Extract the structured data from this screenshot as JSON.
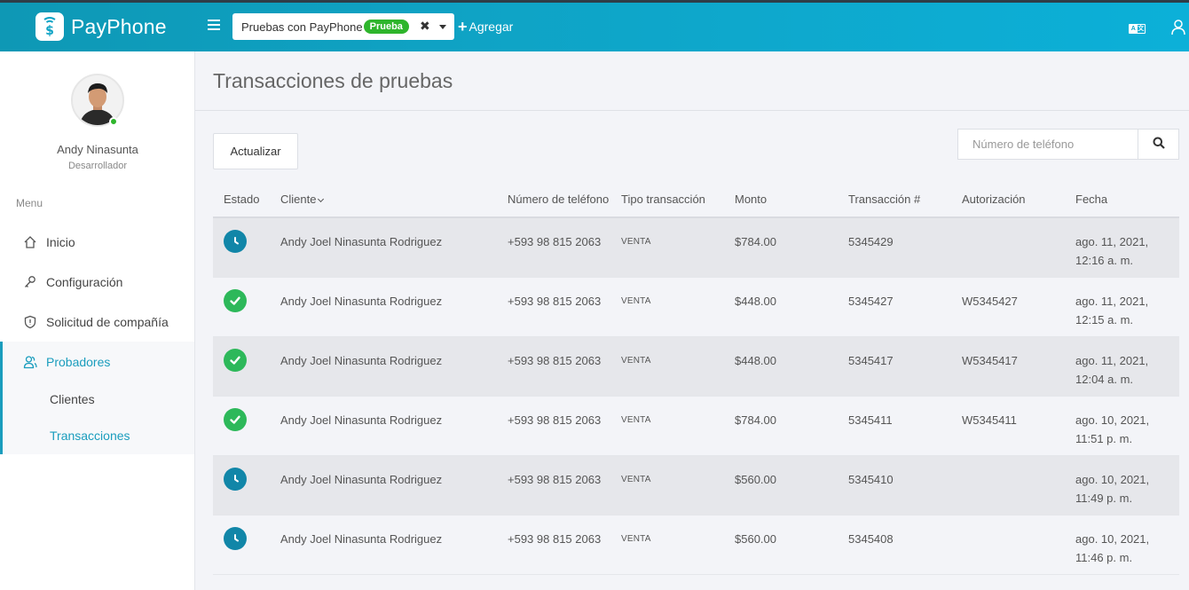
{
  "header": {
    "brand": "PayPhone",
    "app_selector": {
      "name": "Pruebas con PayPhone",
      "badge": "Prueba"
    },
    "add_label": "Agregar"
  },
  "sidebar": {
    "user": {
      "name": "Andy Ninasunta",
      "role": "Desarrollador"
    },
    "menu_title": "Menu",
    "items": [
      {
        "label": "Inicio",
        "icon": "home-icon"
      },
      {
        "label": "Configuración",
        "icon": "key-icon"
      },
      {
        "label": "Solicitud de compañía",
        "icon": "shield-icon"
      },
      {
        "label": "Probadores",
        "icon": "users-icon",
        "active": true
      }
    ],
    "subitems": [
      {
        "label": "Clientes"
      },
      {
        "label": "Transacciones",
        "active": true
      }
    ]
  },
  "main": {
    "title": "Transacciones de pruebas",
    "refresh_label": "Actualizar",
    "search": {
      "placeholder": "Número de teléfono",
      "value": ""
    },
    "table": {
      "columns": [
        "Estado",
        "Cliente",
        "Número de teléfono",
        "Tipo transacción",
        "Monto",
        "Transacción #",
        "Autorización",
        "Fecha"
      ],
      "rows": [
        {
          "status": "pending",
          "client": "Andy Joel Ninasunta Rodriguez",
          "phone": "+593 98 815 2063",
          "type": "VENTA",
          "amount": "$784.00",
          "txn": "5345429",
          "auth": "",
          "date": "ago. 11, 2021,",
          "time": "12:16 a. m."
        },
        {
          "status": "approved",
          "client": "Andy Joel Ninasunta Rodriguez",
          "phone": "+593 98 815 2063",
          "type": "VENTA",
          "amount": "$448.00",
          "txn": "5345427",
          "auth": "W5345427",
          "date": "ago. 11, 2021,",
          "time": "12:15 a. m."
        },
        {
          "status": "approved",
          "client": "Andy Joel Ninasunta Rodriguez",
          "phone": "+593 98 815 2063",
          "type": "VENTA",
          "amount": "$448.00",
          "txn": "5345417",
          "auth": "W5345417",
          "date": "ago. 11, 2021,",
          "time": "12:04 a. m."
        },
        {
          "status": "approved",
          "client": "Andy Joel Ninasunta Rodriguez",
          "phone": "+593 98 815 2063",
          "type": "VENTA",
          "amount": "$784.00",
          "txn": "5345411",
          "auth": "W5345411",
          "date": "ago. 10, 2021,",
          "time": "11:51 p. m."
        },
        {
          "status": "pending",
          "client": "Andy Joel Ninasunta Rodriguez",
          "phone": "+593 98 815 2063",
          "type": "VENTA",
          "amount": "$560.00",
          "txn": "5345410",
          "auth": "",
          "date": "ago. 10, 2021,",
          "time": "11:49 p. m."
        },
        {
          "status": "pending",
          "client": "Andy Joel Ninasunta Rodriguez",
          "phone": "+593 98 815 2063",
          "type": "VENTA",
          "amount": "$560.00",
          "txn": "5345408",
          "auth": "",
          "date": "ago. 10, 2021,",
          "time": "11:46 p. m."
        }
      ]
    }
  },
  "colors": {
    "brand": "#0fa3c5",
    "accent": "#1a9dbd",
    "approved": "#2db85a",
    "pending": "#1186a8",
    "badge": "#2eb52c"
  }
}
